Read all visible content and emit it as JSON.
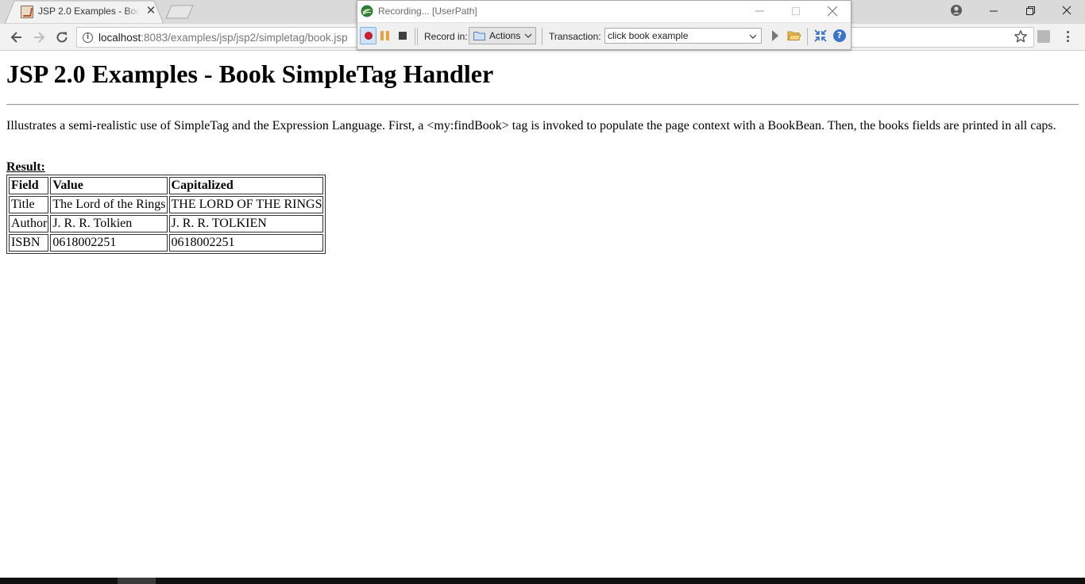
{
  "browser": {
    "tab": {
      "title": "JSP 2.0 Examples - Book SimpleTag Handler"
    },
    "address": {
      "host": "localhost",
      "path": ":8083/examples/jsp/jsp2/simpletag/book.jsp"
    }
  },
  "page": {
    "title": "JSP 2.0 Examples - Book SimpleTag Handler",
    "intro": "Illustrates a semi-realistic use of SimpleTag and the Expression Language. First, a <my:findBook> tag is invoked to populate the page context with a BookBean. Then, the books fields are printed in all caps.",
    "result_label": "Result:",
    "table": {
      "headers": [
        "Field",
        "Value",
        "Capitalized"
      ],
      "rows": [
        [
          "Title",
          "The Lord of the Rings",
          "THE LORD OF THE RINGS"
        ],
        [
          "Author",
          "J. R. R. Tolkien",
          "J. R. R. TOLKIEN"
        ],
        [
          "ISBN",
          "0618002251",
          "0618002251"
        ]
      ]
    }
  },
  "recorder": {
    "title": "Recording... [UserPath]",
    "record_in_label": "Record in:",
    "record_in_value": "Actions",
    "transaction_label": "Transaction:",
    "transaction_value": "click book example"
  },
  "icons": {
    "tab_close": "close-icon",
    "back": "arrow-left-icon",
    "forward": "arrow-right-icon",
    "reload": "reload-icon",
    "site_info": "info-icon",
    "bookmark": "star-icon",
    "menu": "three-dots-icon",
    "record": "record-icon",
    "pause": "pause-icon",
    "stop": "stop-icon",
    "help": "help-icon"
  },
  "colors": {
    "tab_bar": "#dadada",
    "toolbar": "#f2f2f2",
    "record_red": "#d21f2e",
    "pause_orange": "#e8a33c",
    "help_blue": "#3a73c8"
  }
}
